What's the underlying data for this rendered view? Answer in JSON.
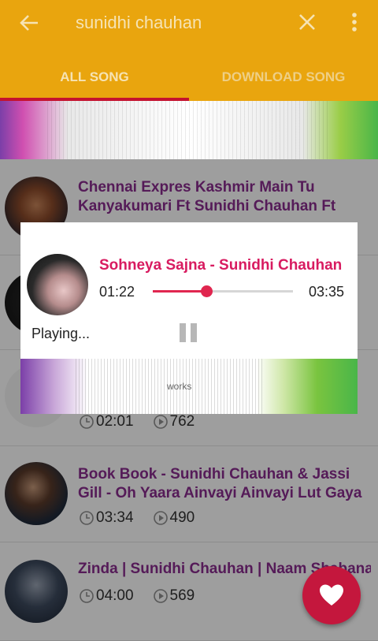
{
  "app_bar": {
    "search_query": "sunidhi chauhan",
    "tabs": [
      {
        "label": "ALL SONG"
      },
      {
        "label": "DOWNLOAD SONG"
      }
    ]
  },
  "songs": [
    {
      "title": "Chennai Expres Kashmir Main Tu Kanyakumari Ft Sunidhi Chauhan Ft",
      "duration": "",
      "plays": ""
    },
    {
      "title": "",
      "duration": "",
      "plays": ""
    },
    {
      "title": "",
      "duration": "02:01",
      "plays": "762"
    },
    {
      "title": "Book Book - Sunidhi Chauhan & Jassi Gill - Oh Yaara Ainvayi Ainvayi Lut Gaya",
      "duration": "03:34",
      "plays": "490"
    },
    {
      "title": "Zinda | Sunidhi Chauhan | Naam Shabana",
      "duration": "04:00",
      "plays": "569"
    }
  ],
  "player": {
    "song_title": "Sohneya Sajna - Sunidhi Chauhan",
    "current_time": "01:22",
    "total_time": "03:35",
    "progress_fraction": 0.38,
    "status": "Playing...",
    "visualizer_text": "works"
  },
  "colors": {
    "primary": "#e9a50e",
    "accent": "#c4122f",
    "title_text": "#8a2c8f",
    "player_title": "#d81b60"
  }
}
